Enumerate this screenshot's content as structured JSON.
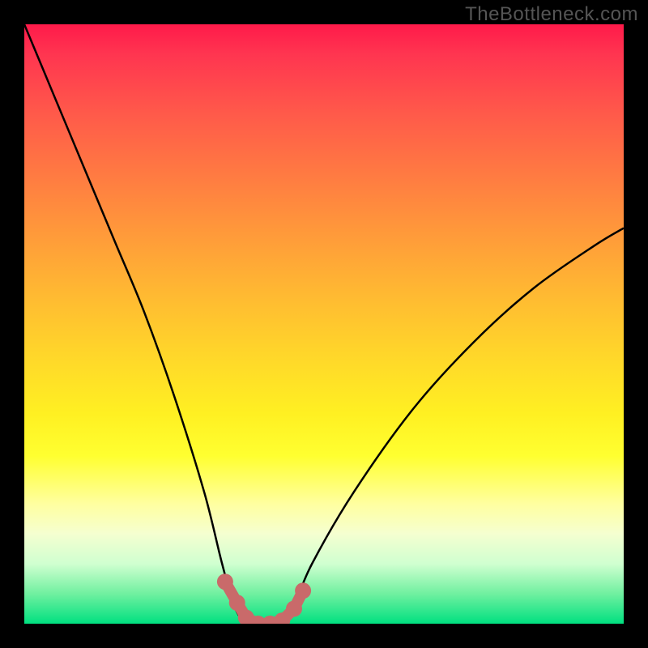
{
  "attribution": "TheBottleneck.com",
  "chart_data": {
    "type": "line",
    "title": "",
    "xlabel": "",
    "ylabel": "",
    "x": [
      0.0,
      0.05,
      0.1,
      0.15,
      0.2,
      0.25,
      0.3,
      0.33,
      0.35,
      0.37,
      0.39,
      0.41,
      0.43,
      0.45,
      0.48,
      0.55,
      0.65,
      0.75,
      0.85,
      0.95,
      1.0
    ],
    "values": [
      1.0,
      0.88,
      0.76,
      0.64,
      0.52,
      0.38,
      0.22,
      0.1,
      0.03,
      0.0,
      0.0,
      0.0,
      0.0,
      0.03,
      0.1,
      0.22,
      0.36,
      0.47,
      0.56,
      0.63,
      0.66
    ],
    "xlim": [
      0,
      1
    ],
    "ylim": [
      0,
      1
    ],
    "markers": {
      "x": [
        0.335,
        0.355,
        0.37,
        0.39,
        0.41,
        0.43,
        0.45,
        0.465
      ],
      "y": [
        0.07,
        0.035,
        0.01,
        0.0,
        0.0,
        0.005,
        0.025,
        0.055
      ]
    }
  },
  "colors": {
    "curve": "#000000",
    "marker": "#c96a6a",
    "bg": "#000000"
  }
}
